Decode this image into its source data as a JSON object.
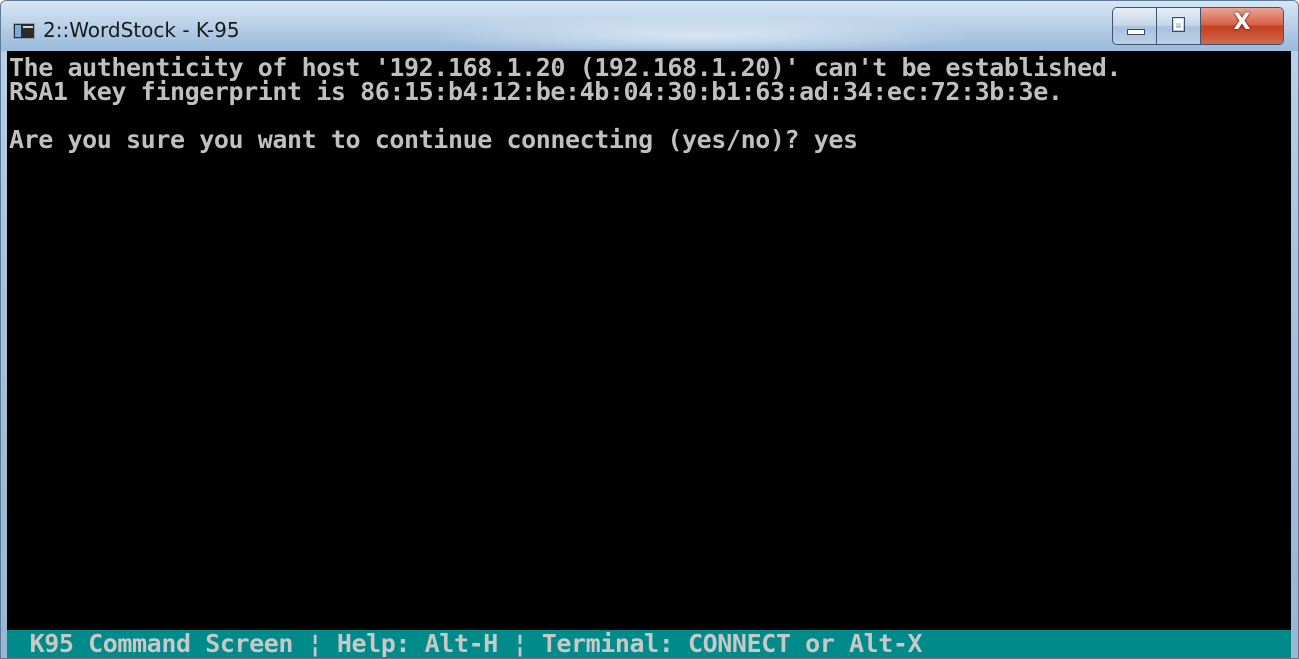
{
  "window": {
    "title": "2::WordStock - K-95",
    "icon": "terminal-app-icon",
    "controls": {
      "minimize_icon": "minimize-icon",
      "maximize_icon": "restore-icon",
      "close_icon": "close-icon",
      "close_glyph": "X"
    }
  },
  "terminal": {
    "lines": [
      "The authenticity of host '192.168.1.20 (192.168.1.20)' can't be established.",
      "RSA1 key fingerprint is 86:15:b4:12:be:4b:04:30:b1:63:ad:34:ec:72:3b:3e.",
      "",
      "Are you sure you want to continue connecting (yes/no)? yes"
    ],
    "colors": {
      "background": "#000000",
      "foreground": "#c0c0c0"
    }
  },
  "statusbar": {
    "text": " K95 Command Screen ¦ Help: Alt-H ¦ Terminal: CONNECT or Alt-X",
    "colors": {
      "background": "#008a8a",
      "foreground": "#c8c8c8"
    }
  }
}
